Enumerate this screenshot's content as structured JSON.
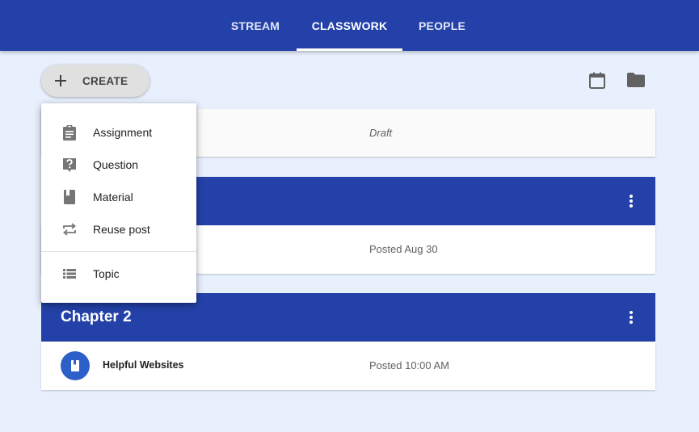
{
  "nav": {
    "tabs": [
      {
        "label": "STREAM"
      },
      {
        "label": "CLASSWORK"
      },
      {
        "label": "PEOPLE"
      }
    ],
    "active_tab": "CLASSWORK"
  },
  "toolbar": {
    "create_label": "CREATE",
    "icons": [
      "calendar-icon",
      "folder-icon"
    ]
  },
  "create_menu": {
    "items": [
      {
        "label": "Assignment",
        "icon": "assignment-icon"
      },
      {
        "label": "Question",
        "icon": "question-icon"
      },
      {
        "label": "Material",
        "icon": "material-icon"
      },
      {
        "label": "Reuse post",
        "icon": "reuse-icon"
      },
      {
        "label": "Topic",
        "icon": "topic-icon"
      }
    ]
  },
  "draft_card": {
    "status": "Draft"
  },
  "topics": [
    {
      "title": "",
      "rows": [
        {
          "title": "",
          "date": "Posted Aug 30"
        }
      ]
    },
    {
      "title": "Chapter 2",
      "rows": [
        {
          "title": "Helpful Websites",
          "date": "Posted 10:00 AM",
          "icon": "material-icon"
        }
      ]
    }
  ],
  "colors": {
    "primary": "#2341a8",
    "background": "#e8effd",
    "avatar": "#2d5fc9"
  }
}
